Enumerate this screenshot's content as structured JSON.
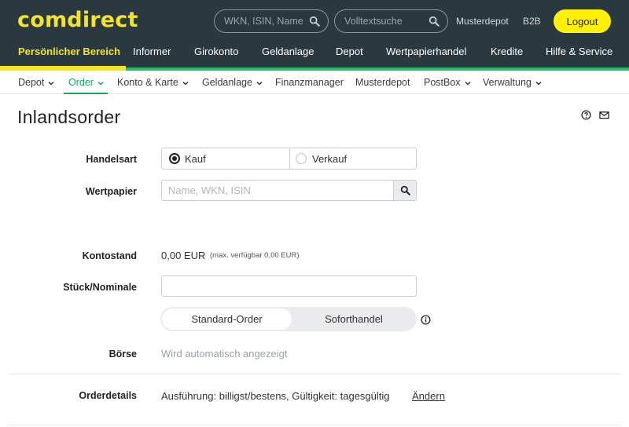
{
  "header": {
    "brand": "comdirect",
    "search_wkn_placeholder": "WKN, ISIN, Name",
    "search_fulltext_placeholder": "Volltextsuche",
    "musterdepot": "Musterdepot",
    "b2b": "B2B",
    "logout": "Logout"
  },
  "main_nav": [
    {
      "label": "Persönlicher Bereich",
      "active": true
    },
    {
      "label": "Informer"
    },
    {
      "label": "Girokonto"
    },
    {
      "label": "Geldanlage"
    },
    {
      "label": "Depot"
    },
    {
      "label": "Wertpapierhandel"
    },
    {
      "label": "Kredite"
    },
    {
      "label": "Hilfe & Service"
    }
  ],
  "sub_nav": [
    {
      "label": "Depot",
      "dropdown": true
    },
    {
      "label": "Order",
      "dropdown": true,
      "active": true
    },
    {
      "label": "Konto & Karte",
      "dropdown": true
    },
    {
      "label": "Geldanlage",
      "dropdown": true
    },
    {
      "label": "Finanzmanager"
    },
    {
      "label": "Musterdepot"
    },
    {
      "label": "PostBox",
      "dropdown": true
    },
    {
      "label": "Verwaltung",
      "dropdown": true
    }
  ],
  "page": {
    "title": "Inlandsorder"
  },
  "form": {
    "handelsart_label": "Handelsart",
    "handelsart_options": [
      "Kauf",
      "Verkauf"
    ],
    "handelsart_selected": "Kauf",
    "wertpapier_label": "Wertpapier",
    "wertpapier_placeholder": "Name, WKN, ISIN",
    "kontostand_label": "Kontostand",
    "kontostand_value": "0,00 EUR",
    "kontostand_note": "(max. verfügbar 0,00 EUR)",
    "stueck_label": "Stück/Nominale",
    "stueck_value": "",
    "order_type_options": [
      "Standard-Order",
      "Sofort­handel"
    ],
    "order_type_selected": "Standard-Order",
    "boerse_label": "Börse",
    "boerse_value": "Wird automatisch angezeigt",
    "orderdetails_label": "Orderdetails",
    "orderdetails_value": "Ausführung: billigst/bestens, Gültigkeit: tagesgültig",
    "orderdetails_link": "Ändern"
  },
  "colors": {
    "header_bg": "#2a3840",
    "brand_yellow": "#f5e51d",
    "logout_yellow": "#fff200",
    "accent_green": "#17a85a"
  }
}
